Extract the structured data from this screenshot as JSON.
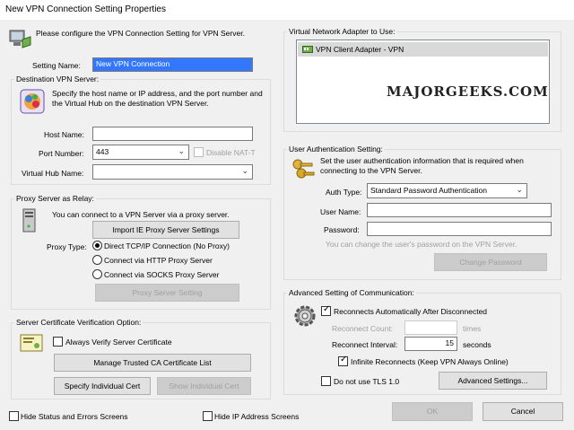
{
  "window": {
    "title": "New VPN Connection Setting Properties"
  },
  "intro": {
    "text": "Please configure the VPN Connection Setting for VPN Server."
  },
  "setting_name": {
    "label": "Setting Name:",
    "value": "New VPN Connection"
  },
  "destination": {
    "legend": "Destination VPN Server:",
    "description": "Specify the host name or IP address, and the port number and the Virtual Hub on the destination VPN Server.",
    "host_label": "Host Name:",
    "host_value": "",
    "port_label": "Port Number:",
    "port_value": "443",
    "disable_nat_label": "Disable NAT-T",
    "hub_label": "Virtual Hub Name:",
    "hub_value": ""
  },
  "proxy": {
    "legend": "Proxy Server as Relay:",
    "description": "You can connect to a VPN Server via a proxy server.",
    "import_button": "Import IE Proxy Server Settings",
    "type_label": "Proxy Type:",
    "options": [
      "Direct TCP/IP Connection (No Proxy)",
      "Connect via HTTP Proxy Server",
      "Connect via SOCKS Proxy Server"
    ],
    "setting_button": "Proxy Server Setting"
  },
  "certificate": {
    "legend": "Server Certificate Verification Option:",
    "always_verify_label": "Always Verify Server Certificate",
    "manage_button": "Manage Trusted CA Certificate List",
    "specify_button": "Specify Individual Cert",
    "show_button": "Show Individual Cert"
  },
  "bottom": {
    "hide_status_label": "Hide Status and Errors Screens",
    "hide_ip_label": "Hide IP Address Screens",
    "ok_button": "OK",
    "cancel_button": "Cancel"
  },
  "adapter": {
    "legend": "Virtual Network Adapter to Use:",
    "items": [
      "VPN Client Adapter - VPN"
    ]
  },
  "watermark": "MAJORGEEKS.COM",
  "auth": {
    "legend": "User Authentication Setting:",
    "description": "Set the user authentication information that is required when connecting to the VPN Server.",
    "type_label": "Auth Type:",
    "type_value": "Standard Password Authentication",
    "user_label": "User Name:",
    "user_value": "",
    "password_label": "Password:",
    "password_value": "",
    "hint": "You can change the user's password on the VPN Server.",
    "change_button": "Change Password"
  },
  "advanced": {
    "legend": "Advanced Setting of Communication:",
    "reconnect_label": "Reconnects Automatically After Disconnected",
    "reconnect_count_label": "Reconnect Count:",
    "reconnect_count_value": "",
    "times_label": "times",
    "interval_label": "Reconnect Interval:",
    "interval_value": "15",
    "seconds_label": "seconds",
    "infinite_label": "Infinite Reconnects (Keep VPN Always Online)",
    "no_tls_label": "Do not use TLS 1.0",
    "advanced_button": "Advanced Settings..."
  }
}
